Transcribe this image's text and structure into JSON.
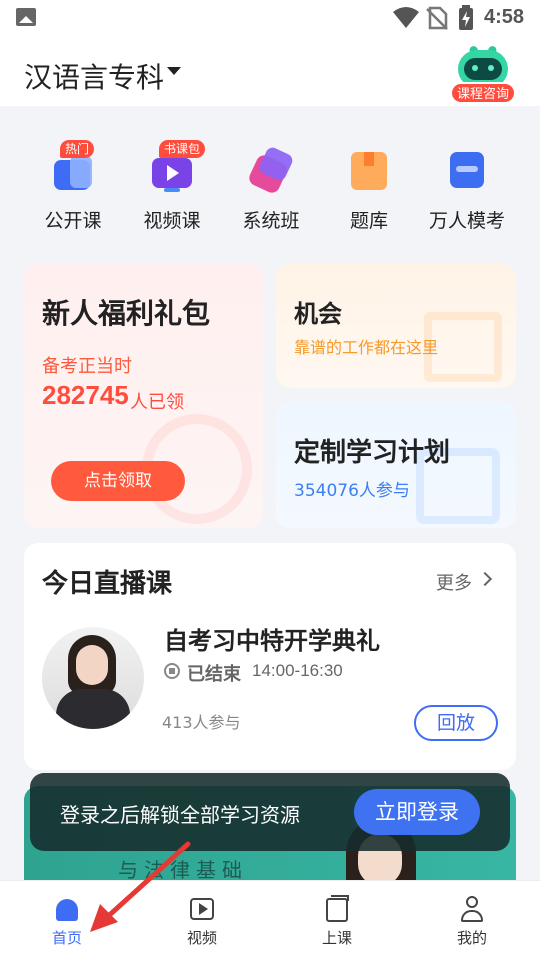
{
  "status_bar": {
    "time": "4:58"
  },
  "header": {
    "subject": "汉语言专科",
    "consult_label": "课程咨询"
  },
  "categories": [
    {
      "label": "公开课",
      "badge": "热门",
      "icon": "open-class-icon"
    },
    {
      "label": "视频课",
      "badge": "书课包",
      "icon": "video-class-icon"
    },
    {
      "label": "系统班",
      "badge": "",
      "icon": "system-class-icon"
    },
    {
      "label": "题库",
      "badge": "",
      "icon": "question-bank-icon"
    },
    {
      "label": "万人模考",
      "badge": "",
      "icon": "mock-exam-icon"
    }
  ],
  "gift_card": {
    "title": "新人福利礼包",
    "subtitle": "备考正当时",
    "count": "282745",
    "count_unit": "人已领",
    "button": "点击领取"
  },
  "chance_card": {
    "title": "机会",
    "subtitle": "靠谱的工作都在这里"
  },
  "plan_card": {
    "title": "定制学习计划",
    "subtitle": "354076人参与"
  },
  "live": {
    "title": "今日直播课",
    "more": "更多",
    "course": "自考习中特开学典礼",
    "status": "已结束",
    "time": "14:00-16:30",
    "participants": "413人参与",
    "replay": "回放"
  },
  "banner": {
    "text": "与法律基础"
  },
  "login_bar": {
    "text": "登录之后解锁全部学习资源",
    "button": "立即登录"
  },
  "tabs": [
    {
      "label": "首页",
      "active": true
    },
    {
      "label": "视频",
      "active": false
    },
    {
      "label": "上课",
      "active": false
    },
    {
      "label": "我的",
      "active": false
    }
  ],
  "colors": {
    "accent": "#3f6cf4",
    "brand_red": "#ff4d3d",
    "orange": "#f59a2c",
    "annotation_arrow": "#e53935"
  }
}
